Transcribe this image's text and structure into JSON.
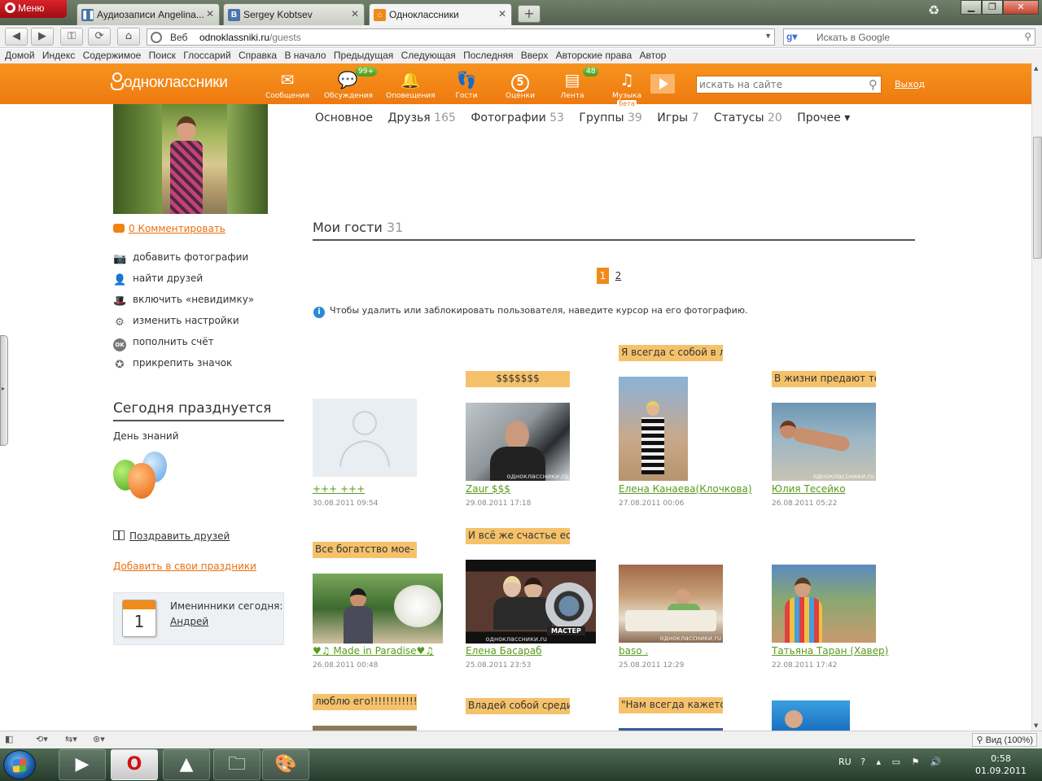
{
  "browser": {
    "menu_label": "Меню",
    "tabs": [
      {
        "title": "Аудиозаписи Angelina..."
      },
      {
        "title": "Sergey Kobtsev"
      },
      {
        "title": "Одноклассники"
      }
    ],
    "address": {
      "prefix": "Веб",
      "host": "odnoklassniki.ru",
      "path": "/guests"
    },
    "search_placeholder": "Искать в Google",
    "bookmarks": [
      "Домой",
      "Индекс",
      "Содержимое",
      "Поиск",
      "Глоссарий",
      "Справка",
      "В начало",
      "Предыдущая",
      "Следующая",
      "Последняя",
      "Вверх",
      "Авторские права",
      "Автор"
    ],
    "zoom": "Вид (100%)"
  },
  "site": {
    "logo": "одноклассники",
    "nav": [
      {
        "label": "Сообщения",
        "icon": "envelope-icon"
      },
      {
        "label": "Обсуждения",
        "icon": "chat-bubbles-icon",
        "badge": "99+"
      },
      {
        "label": "Оповещения",
        "icon": "bell-icon"
      },
      {
        "label": "Гости",
        "icon": "footprints-icon"
      },
      {
        "label": "Оценки",
        "icon": "five-rating-icon",
        "glyph": "5"
      },
      {
        "label": "Лента",
        "icon": "feed-icon",
        "badge": "48"
      },
      {
        "label": "Музыка",
        "icon": "music-note-icon",
        "beta": "бета"
      }
    ],
    "search_placeholder": "искать на сайте",
    "logout": "Выход"
  },
  "left": {
    "comment_link": "0 Комментировать",
    "actions": [
      {
        "label": "добавить фотографии",
        "icon": "camera-icon"
      },
      {
        "label": "найти друзей",
        "icon": "person-icon"
      },
      {
        "label": "включить «невидимку»",
        "icon": "hat-icon"
      },
      {
        "label": "изменить настройки",
        "icon": "gear-icon"
      },
      {
        "label": "пополнить счёт",
        "icon": "ok-coin-icon",
        "glyph": "OK"
      },
      {
        "label": "прикрепить значок",
        "icon": "star-badge-icon"
      }
    ],
    "today_heading": "Сегодня празднуется",
    "today_holiday": "День знаний",
    "congrats_link": "Поздравить друзей",
    "add_holiday_link": "Добавить в свои праздники",
    "namedays": {
      "label": "Именинники сегодня:",
      "name": "Андрей",
      "day": "1"
    }
  },
  "profile_nav": [
    {
      "label": "Основное",
      "count": ""
    },
    {
      "label": "Друзья",
      "count": "165"
    },
    {
      "label": "Фотографии",
      "count": "53"
    },
    {
      "label": "Группы",
      "count": "39"
    },
    {
      "label": "Игры",
      "count": "7"
    },
    {
      "label": "Статусы",
      "count": "20"
    },
    {
      "label": "Прочее ▾",
      "count": ""
    }
  ],
  "guests": {
    "heading": "Мои гости",
    "count": "31",
    "pages": [
      "1",
      "2"
    ],
    "info": "Чтобы удалить или заблокировать пользователя, наведите курсор на его фотографию.",
    "watermark": "одноклассники.ru",
    "items": [
      {
        "name": "+++ +++",
        "date": "30.08.2011 09:54",
        "status": ""
      },
      {
        "name": "Zaur $$$",
        "date": "29.08.2011 17:18",
        "status": "$$$$$$$"
      },
      {
        "name": "Елена Канаева(Клочкова)",
        "date": "27.08.2011 00:06",
        "status": "Я всегда с собой в ла,"
      },
      {
        "name": "Юлия Тесейко",
        "date": "26.08.2011 05:22",
        "status": "В жизни предают теб"
      },
      {
        "name": "♥♫ Made in Paradise♥♫",
        "date": "26.08.2011 00:48",
        "status": "Все богатство мое- в"
      },
      {
        "name": "Елена Басараб",
        "date": "25.08.2011 23:53",
        "status": "И всё же счастье есть",
        "badge": "МАСТЕР"
      },
      {
        "name": "baso .",
        "date": "25.08.2011 12:29",
        "status": ""
      },
      {
        "name": "Татьяна Таран (Хавер)",
        "date": "22.08.2011 17:42",
        "status": ""
      },
      {
        "status": "люблю его!!!!!!!!!!!!!!!!"
      },
      {
        "status": "Владей собой среди"
      },
      {
        "status": "\"Нам всегда кажется,"
      }
    ]
  },
  "taskbar": {
    "lang": "RU",
    "time": "0:58",
    "date": "01.09.2011"
  }
}
